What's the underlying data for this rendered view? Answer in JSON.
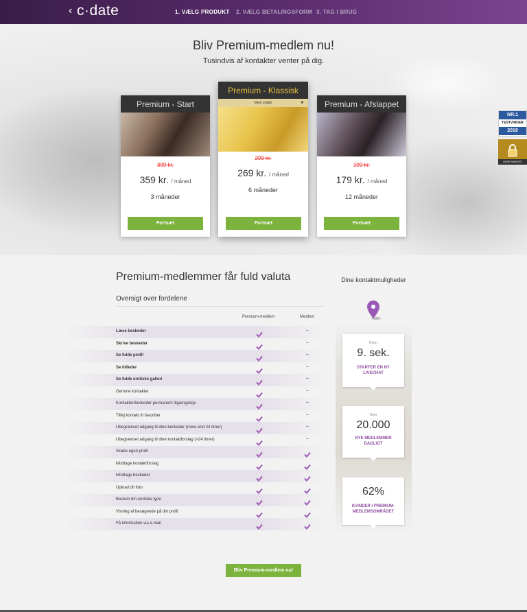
{
  "header": {
    "back_icon": "chevron-left-icon",
    "logo": "c·date",
    "steps": [
      "1. VÆLG PRODUKT",
      "2. VÆLG BETALINGSFORM",
      "3. TAG I BRUG"
    ]
  },
  "hero": {
    "title": "Bliv Premium-medlem nu!",
    "subtitle": "Tusindvis af kontakter venter på dig."
  },
  "plans": [
    {
      "name": "Premium - Start",
      "old_price": "399 kr.",
      "price": "359 kr.",
      "per": "/ måned",
      "duration": "3 måneder",
      "button": "Fortsæt"
    },
    {
      "name": "Premium - Klassisk",
      "ribbon": "Mest solgte",
      "old_price": "299 kr.",
      "price": "269 kr.",
      "per": "/ måned",
      "duration": "6 måneder",
      "button": "Fortsæt"
    },
    {
      "name": "Premium - Afslappet",
      "old_price": "199 kr.",
      "price": "179 kr.",
      "per": "/ måned",
      "duration": "12 måneder",
      "button": "Fortsæt"
    }
  ],
  "badges": {
    "award_top": "NR.1",
    "award_mid": "TESTVINDER",
    "award_year": "2019",
    "secure": "100% SIKKERT"
  },
  "benefits": {
    "title": "Premium-medlemmer får fuld valuta",
    "subtitle": "Oversigt over fordelene",
    "col_premium": "Premium-medlem",
    "col_member": "Medlem",
    "rows": [
      {
        "label": "Læse beskeder",
        "bold": true,
        "member": false
      },
      {
        "label": "Skrive beskeder",
        "bold": true,
        "member": false
      },
      {
        "label": "Se fulde profil",
        "bold": true,
        "member": false
      },
      {
        "label": "Se billeder",
        "bold": true,
        "member": false
      },
      {
        "label": "Se fulde erotiske galleri",
        "bold": true,
        "member": false
      },
      {
        "label": "Gemme kontakter",
        "bold": false,
        "member": false
      },
      {
        "label": "Kontakter/beskeder permanent tilgængelige",
        "bold": false,
        "member": false
      },
      {
        "label": "Tilføj kontakt til favoritter",
        "bold": false,
        "member": false
      },
      {
        "label": "Ubegrænset adgang til dine beskeder (mere end 24 timer)",
        "bold": false,
        "member": false
      },
      {
        "label": "Ubegrænset adgang til dine kontaktforslag (>24 timer)",
        "bold": false,
        "member": false
      },
      {
        "label": "Skabe egen profil",
        "bold": false,
        "member": true
      },
      {
        "label": "Modtage kontaktforslag",
        "bold": false,
        "member": true
      },
      {
        "label": "Modtage beskeder",
        "bold": false,
        "member": true
      },
      {
        "label": "Upload dit foto",
        "bold": false,
        "member": true
      },
      {
        "label": "Bestem din erotiske type",
        "bold": false,
        "member": true
      },
      {
        "label": "Visning af besøgende på din profil",
        "bold": false,
        "member": true
      },
      {
        "label": "Få information via e-mail",
        "bold": false,
        "member": true
      }
    ],
    "dash": "–"
  },
  "contacts": {
    "title": "Dine kontaktmuligheder",
    "stats": [
      {
        "small": "Hvert",
        "big": "9. sek.",
        "label": "STARTER EN NY LIVECHAT"
      },
      {
        "small": "Over",
        "big": "20.000",
        "label": "NYE MEDLEMMER DAGLIGT"
      },
      {
        "small": "",
        "big": "62%",
        "label": "KVINDER I PREMIUM-MEDLEMSOMRÅDET"
      }
    ]
  },
  "cta": {
    "label": "Bliv Premium-medlem nu!"
  },
  "colors": {
    "purple": "#5b2d6e",
    "green": "#7bb33c",
    "check": "#9b59b6",
    "strike": "#e33333"
  }
}
